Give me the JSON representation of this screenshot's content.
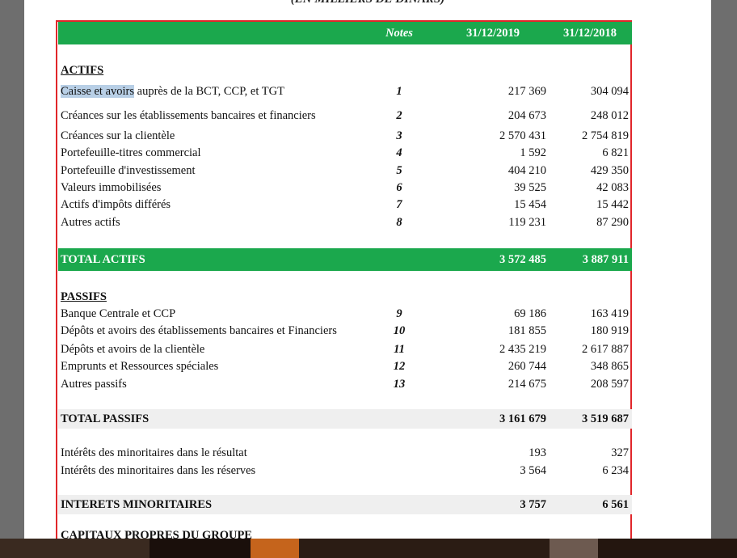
{
  "document": {
    "unit_note": "(EN MILLIERS DE DINARS)",
    "columns": {
      "notes": "Notes",
      "col1": "31/12/2019",
      "col2": "31/12/2018"
    },
    "actifs": {
      "title": "ACTIFS",
      "rows": [
        {
          "label_highlight": "Caisse et avoirs",
          "label_rest": " auprès de la BCT, CCP, et TGT",
          "note": "1",
          "v2019": "217 369",
          "v2018": "304 094"
        },
        {
          "label": "Créances sur les établissements bancaires et financiers",
          "note": "2",
          "v2019": "204 673",
          "v2018": "248 012"
        },
        {
          "label": "Créances sur la clientèle",
          "note": "3",
          "v2019": "2 570 431",
          "v2018": "2 754 819"
        },
        {
          "label": "Portefeuille-titres commercial",
          "note": "4",
          "v2019": "1 592",
          "v2018": "6 821"
        },
        {
          "label": "Portefeuille d'investissement",
          "note": "5",
          "v2019": "404 210",
          "v2018": "429 350"
        },
        {
          "label": "Valeurs immobilisées",
          "note": "6",
          "v2019": "39 525",
          "v2018": "42 083"
        },
        {
          "label": "Actifs d'impôts différés",
          "note": "7",
          "v2019": "15 454",
          "v2018": "15 442"
        },
        {
          "label": "Autres actifs",
          "note": "8",
          "v2019": "119 231",
          "v2018": "87 290"
        }
      ],
      "total": {
        "label": "TOTAL ACTIFS",
        "v2019": "3 572 485",
        "v2018": "3 887 911"
      }
    },
    "passifs": {
      "title": "PASSIFS",
      "rows": [
        {
          "label": "Banque Centrale et CCP",
          "note": "9",
          "v2019": "69 186",
          "v2018": "163 419"
        },
        {
          "label": "Dépôts et avoirs des établissements bancaires et Financiers",
          "note": "10",
          "v2019": "181 855",
          "v2018": "180 919"
        },
        {
          "label": "Dépôts et avoirs de la clientèle",
          "note": "11",
          "v2019": "2 435 219",
          "v2018": "2 617 887"
        },
        {
          "label": "Emprunts et Ressources spéciales",
          "note": "12",
          "v2019": "260 744",
          "v2018": "348 865"
        },
        {
          "label": "Autres passifs",
          "note": "13",
          "v2019": "214 675",
          "v2018": "208 597"
        }
      ],
      "total": {
        "label": "TOTAL PASSIFS",
        "v2019": "3 161 679",
        "v2018": "3 519 687"
      }
    },
    "minoritaires": {
      "rows": [
        {
          "label": "Intérêts des minoritaires dans le résultat",
          "v2019": "193",
          "v2018": "327"
        },
        {
          "label": "Intérêts des minoritaires dans les réserves",
          "v2019": "3 564",
          "v2018": "6 234"
        }
      ],
      "total": {
        "label": "INTERETS MINORITAIRES",
        "v2019": "3 757",
        "v2018": "6 561"
      }
    },
    "next_section_cut": "CAPITAUX PROPRES DU GROUPE"
  },
  "colors": {
    "band_green": "#1ba84d",
    "frame_red": "#e1262a",
    "band_grey": "#efefef",
    "selection": "#b8cfe6"
  }
}
